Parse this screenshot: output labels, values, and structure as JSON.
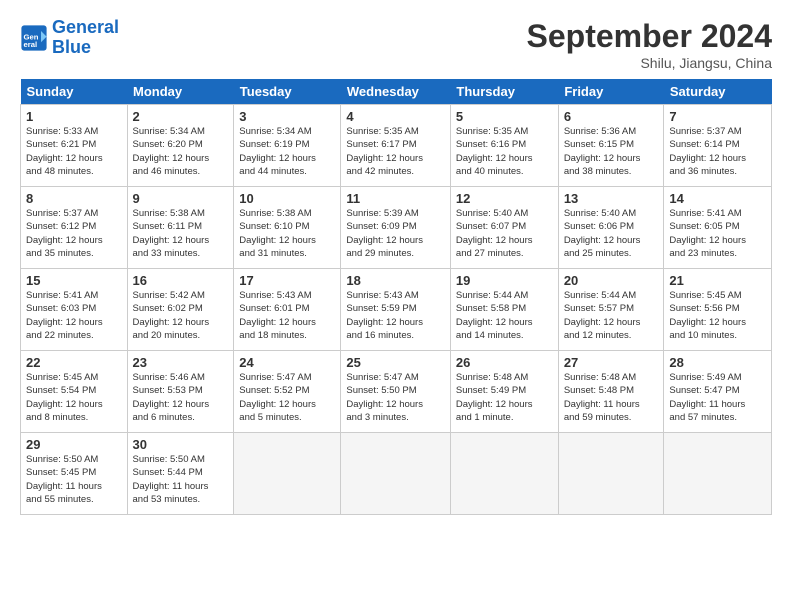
{
  "header": {
    "logo_line1": "General",
    "logo_line2": "Blue",
    "month": "September 2024",
    "location": "Shilu, Jiangsu, China"
  },
  "weekdays": [
    "Sunday",
    "Monday",
    "Tuesday",
    "Wednesday",
    "Thursday",
    "Friday",
    "Saturday"
  ],
  "weeks": [
    [
      {
        "day": "1",
        "detail": "Sunrise: 5:33 AM\nSunset: 6:21 PM\nDaylight: 12 hours\nand 48 minutes."
      },
      {
        "day": "2",
        "detail": "Sunrise: 5:34 AM\nSunset: 6:20 PM\nDaylight: 12 hours\nand 46 minutes."
      },
      {
        "day": "3",
        "detail": "Sunrise: 5:34 AM\nSunset: 6:19 PM\nDaylight: 12 hours\nand 44 minutes."
      },
      {
        "day": "4",
        "detail": "Sunrise: 5:35 AM\nSunset: 6:17 PM\nDaylight: 12 hours\nand 42 minutes."
      },
      {
        "day": "5",
        "detail": "Sunrise: 5:35 AM\nSunset: 6:16 PM\nDaylight: 12 hours\nand 40 minutes."
      },
      {
        "day": "6",
        "detail": "Sunrise: 5:36 AM\nSunset: 6:15 PM\nDaylight: 12 hours\nand 38 minutes."
      },
      {
        "day": "7",
        "detail": "Sunrise: 5:37 AM\nSunset: 6:14 PM\nDaylight: 12 hours\nand 36 minutes."
      }
    ],
    [
      {
        "day": "8",
        "detail": "Sunrise: 5:37 AM\nSunset: 6:12 PM\nDaylight: 12 hours\nand 35 minutes."
      },
      {
        "day": "9",
        "detail": "Sunrise: 5:38 AM\nSunset: 6:11 PM\nDaylight: 12 hours\nand 33 minutes."
      },
      {
        "day": "10",
        "detail": "Sunrise: 5:38 AM\nSunset: 6:10 PM\nDaylight: 12 hours\nand 31 minutes."
      },
      {
        "day": "11",
        "detail": "Sunrise: 5:39 AM\nSunset: 6:09 PM\nDaylight: 12 hours\nand 29 minutes."
      },
      {
        "day": "12",
        "detail": "Sunrise: 5:40 AM\nSunset: 6:07 PM\nDaylight: 12 hours\nand 27 minutes."
      },
      {
        "day": "13",
        "detail": "Sunrise: 5:40 AM\nSunset: 6:06 PM\nDaylight: 12 hours\nand 25 minutes."
      },
      {
        "day": "14",
        "detail": "Sunrise: 5:41 AM\nSunset: 6:05 PM\nDaylight: 12 hours\nand 23 minutes."
      }
    ],
    [
      {
        "day": "15",
        "detail": "Sunrise: 5:41 AM\nSunset: 6:03 PM\nDaylight: 12 hours\nand 22 minutes."
      },
      {
        "day": "16",
        "detail": "Sunrise: 5:42 AM\nSunset: 6:02 PM\nDaylight: 12 hours\nand 20 minutes."
      },
      {
        "day": "17",
        "detail": "Sunrise: 5:43 AM\nSunset: 6:01 PM\nDaylight: 12 hours\nand 18 minutes."
      },
      {
        "day": "18",
        "detail": "Sunrise: 5:43 AM\nSunset: 5:59 PM\nDaylight: 12 hours\nand 16 minutes."
      },
      {
        "day": "19",
        "detail": "Sunrise: 5:44 AM\nSunset: 5:58 PM\nDaylight: 12 hours\nand 14 minutes."
      },
      {
        "day": "20",
        "detail": "Sunrise: 5:44 AM\nSunset: 5:57 PM\nDaylight: 12 hours\nand 12 minutes."
      },
      {
        "day": "21",
        "detail": "Sunrise: 5:45 AM\nSunset: 5:56 PM\nDaylight: 12 hours\nand 10 minutes."
      }
    ],
    [
      {
        "day": "22",
        "detail": "Sunrise: 5:45 AM\nSunset: 5:54 PM\nDaylight: 12 hours\nand 8 minutes."
      },
      {
        "day": "23",
        "detail": "Sunrise: 5:46 AM\nSunset: 5:53 PM\nDaylight: 12 hours\nand 6 minutes."
      },
      {
        "day": "24",
        "detail": "Sunrise: 5:47 AM\nSunset: 5:52 PM\nDaylight: 12 hours\nand 5 minutes."
      },
      {
        "day": "25",
        "detail": "Sunrise: 5:47 AM\nSunset: 5:50 PM\nDaylight: 12 hours\nand 3 minutes."
      },
      {
        "day": "26",
        "detail": "Sunrise: 5:48 AM\nSunset: 5:49 PM\nDaylight: 12 hours\nand 1 minute."
      },
      {
        "day": "27",
        "detail": "Sunrise: 5:48 AM\nSunset: 5:48 PM\nDaylight: 11 hours\nand 59 minutes."
      },
      {
        "day": "28",
        "detail": "Sunrise: 5:49 AM\nSunset: 5:47 PM\nDaylight: 11 hours\nand 57 minutes."
      }
    ],
    [
      {
        "day": "29",
        "detail": "Sunrise: 5:50 AM\nSunset: 5:45 PM\nDaylight: 11 hours\nand 55 minutes."
      },
      {
        "day": "30",
        "detail": "Sunrise: 5:50 AM\nSunset: 5:44 PM\nDaylight: 11 hours\nand 53 minutes."
      },
      {
        "day": "",
        "detail": ""
      },
      {
        "day": "",
        "detail": ""
      },
      {
        "day": "",
        "detail": ""
      },
      {
        "day": "",
        "detail": ""
      },
      {
        "day": "",
        "detail": ""
      }
    ]
  ]
}
